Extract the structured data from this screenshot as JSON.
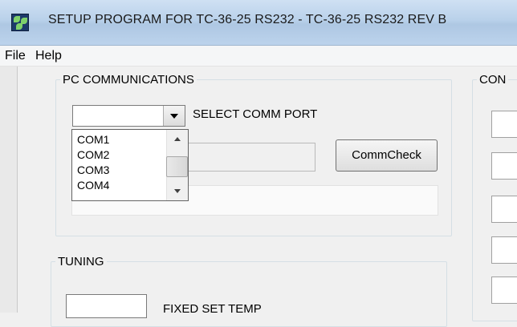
{
  "window": {
    "title": "SETUP PROGRAM FOR TC-36-25 RS232 - TC-36-25 RS232 REV B"
  },
  "menu": {
    "file": "File",
    "help": "Help"
  },
  "pc_comm": {
    "legend": "PC COMMUNICATIONS",
    "select_label": "SELECT COMM PORT",
    "selected_value": "",
    "options": [
      "COM1",
      "COM2",
      "COM3",
      "COM4"
    ],
    "commcheck_label": "CommCheck"
  },
  "right_group": {
    "legend_partial": "CON"
  },
  "tuning": {
    "legend": "TUNING",
    "fixed_set_temp_label": "FIXED SET TEMP"
  }
}
